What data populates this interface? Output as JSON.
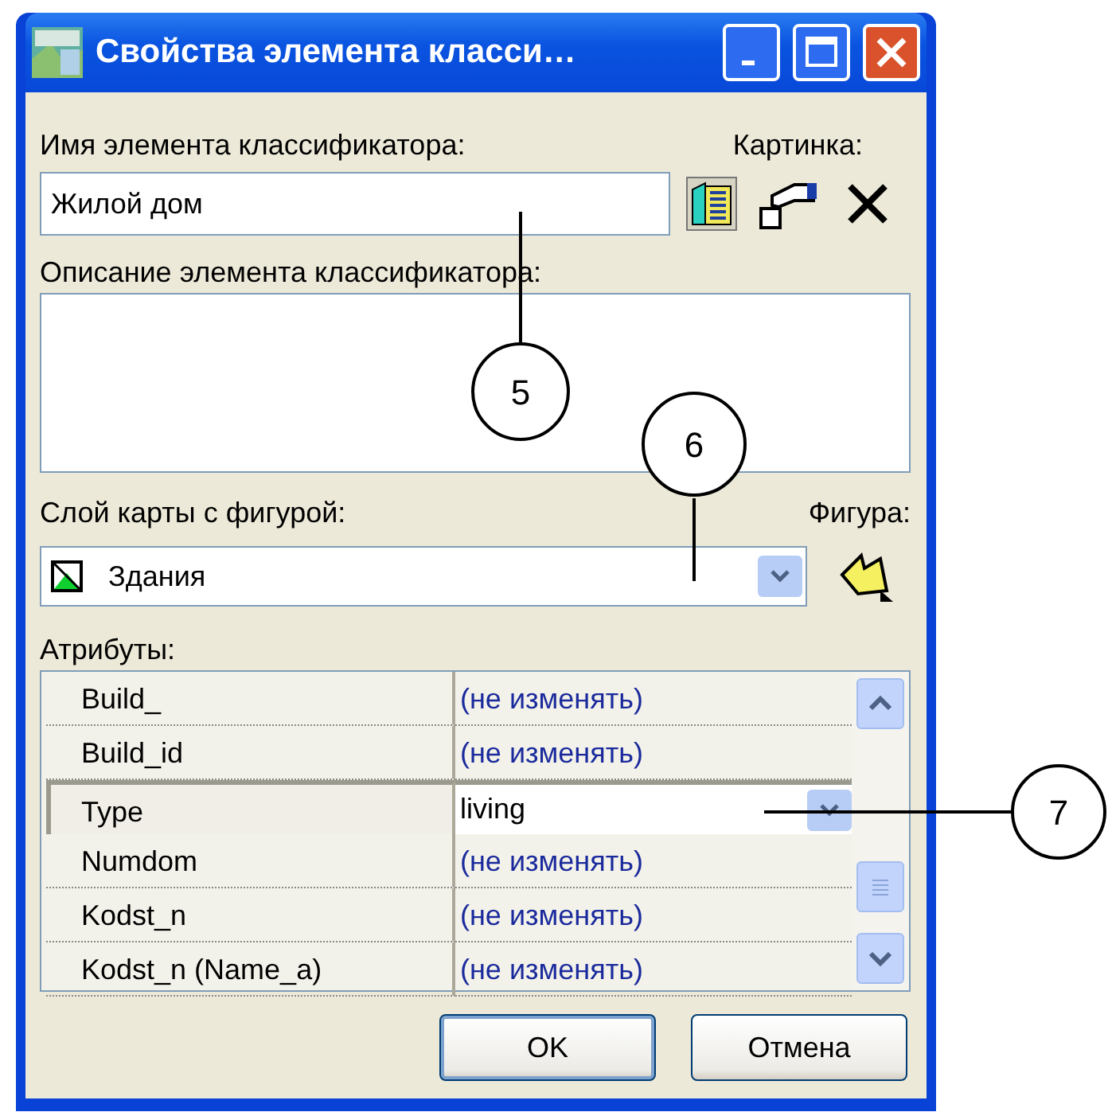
{
  "window": {
    "title": "Свойства элемента класси…"
  },
  "name_label": "Имя элемента классификатора:",
  "name_field": {
    "value": "Жилой дом"
  },
  "picture_label": "Картинка:",
  "description_label": "Описание элемента классификатора:",
  "layer_label": "Слой карты с фигурой:",
  "shape_label": "Фигура:",
  "layer_combo": {
    "value": "Здания"
  },
  "attributes_label": "Атрибуты:",
  "attributes": [
    {
      "name": "Build_",
      "value": "(не изменять)",
      "kind": "unchanged",
      "selected": false
    },
    {
      "name": "Build_id",
      "value": "(не изменять)",
      "kind": "unchanged",
      "selected": false
    },
    {
      "name": "Type",
      "value": "living",
      "kind": "dropdown",
      "selected": true
    },
    {
      "name": "Numdom",
      "value": "(не изменять)",
      "kind": "unchanged",
      "selected": false
    },
    {
      "name": "Kodst_n",
      "value": "(не изменять)",
      "kind": "unchanged",
      "selected": false
    },
    {
      "name": "Kodst_n (Name_a)",
      "value": "(не изменять)",
      "kind": "unchanged",
      "selected": false
    }
  ],
  "buttons": [
    {
      "label": "OK",
      "default": true
    },
    {
      "label": "Отмена",
      "default": false
    }
  ],
  "callouts": [
    {
      "number": "5"
    },
    {
      "number": "6"
    },
    {
      "number": "7"
    }
  ]
}
